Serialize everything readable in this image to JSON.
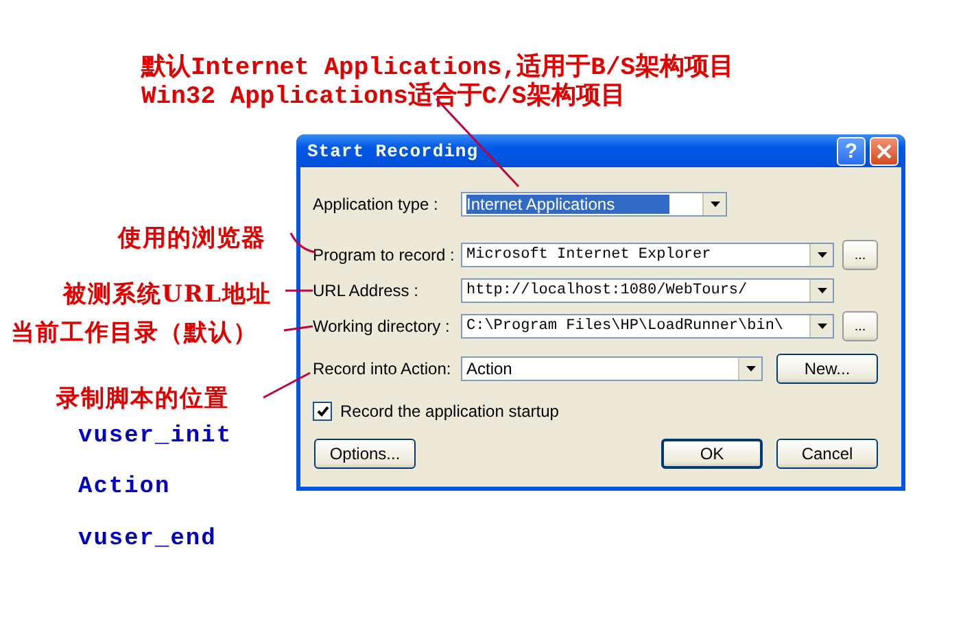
{
  "annotations": [
    {
      "text": "默认Internet Applications,适用于B/S架构项目",
      "kind": "note"
    },
    {
      "text": "Win32 Applications适合于C/S架构项目",
      "kind": "note"
    },
    {
      "text": "使用的浏览器",
      "kind": "callout"
    },
    {
      "text": "被测系统URL地址",
      "kind": "callout"
    },
    {
      "text": "当前工作目录（默认）",
      "kind": "callout"
    },
    {
      "text": "录制脚本的位置",
      "kind": "callout"
    },
    {
      "text": "vuser_init",
      "kind": "code"
    },
    {
      "text": "Action",
      "kind": "code"
    },
    {
      "text": "vuser_end",
      "kind": "code"
    }
  ],
  "dialog": {
    "title": "Start Recording",
    "help": "?",
    "fields": [
      {
        "label": "Application type :",
        "value": "Internet Applications",
        "kind": "dropdown",
        "highlighted": true
      },
      {
        "label": "Program to record :",
        "value": "Microsoft Internet Explorer",
        "kind": "combo",
        "highlighted": false,
        "button": "..."
      },
      {
        "label": "URL Address :",
        "value": "http://localhost:1080/WebTours/",
        "kind": "combo",
        "highlighted": false
      },
      {
        "label": "Working directory :",
        "value": "C:\\Program Files\\HP\\LoadRunner\\bin\\",
        "kind": "combo",
        "highlighted": false,
        "button": "..."
      },
      {
        "label": "Record into Action:",
        "value": "Action",
        "kind": "dropdown",
        "highlighted": false,
        "button": "New..."
      }
    ],
    "checkbox": {
      "label": "Record the application startup",
      "checked": true
    },
    "buttons": [
      "Options...",
      "OK",
      "Cancel"
    ]
  }
}
